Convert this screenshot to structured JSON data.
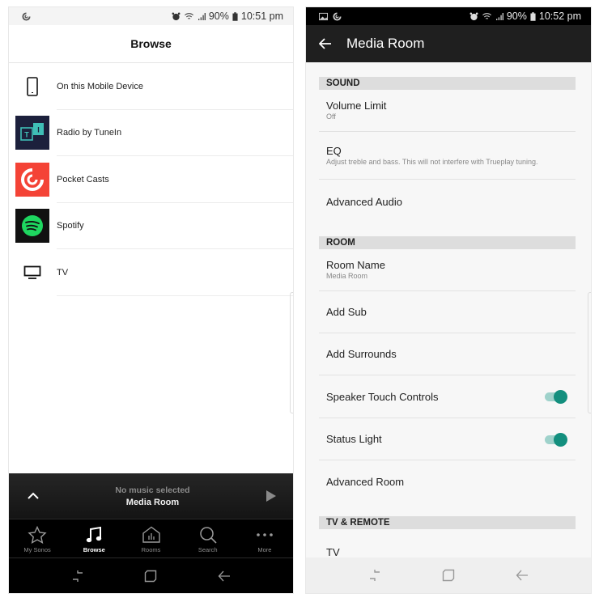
{
  "left_phone": {
    "status_bar": {
      "battery": "90%",
      "time": "10:51 pm"
    },
    "header": {
      "title": "Browse"
    },
    "sources": [
      {
        "label": "On this Mobile Device",
        "icon": "phone-icon"
      },
      {
        "label": "Radio by TuneIn",
        "icon": "tunein-logo-icon"
      },
      {
        "label": "Pocket Casts",
        "icon": "pocket-casts-logo-icon"
      },
      {
        "label": "Spotify",
        "icon": "spotify-logo-icon"
      },
      {
        "label": "TV",
        "icon": "tv-icon"
      }
    ],
    "mini_player": {
      "status": "No music selected",
      "room": "Media Room"
    },
    "tabs": [
      {
        "label": "My Sonos",
        "icon": "star-icon",
        "active": false
      },
      {
        "label": "Browse",
        "icon": "music-note-icon",
        "active": true
      },
      {
        "label": "Rooms",
        "icon": "rooms-icon",
        "active": false
      },
      {
        "label": "Search",
        "icon": "search-icon",
        "active": false
      },
      {
        "label": "More",
        "icon": "more-dots-icon",
        "active": false
      }
    ]
  },
  "right_phone": {
    "status_bar": {
      "battery": "90%",
      "time": "10:52 pm"
    },
    "app_bar": {
      "title": "Media Room"
    },
    "sections": [
      {
        "header": "SOUND",
        "rows": [
          {
            "title": "Volume Limit",
            "subtitle": "Off"
          },
          {
            "title": "EQ",
            "subtitle": "Adjust treble and bass. This will not interfere with Trueplay tuning."
          },
          {
            "title": "Advanced Audio"
          }
        ]
      },
      {
        "header": "ROOM",
        "rows": [
          {
            "title": "Room Name",
            "subtitle": "Media Room"
          },
          {
            "title": "Add Sub"
          },
          {
            "title": "Add Surrounds"
          },
          {
            "title": "Speaker Touch Controls",
            "toggle": true
          },
          {
            "title": "Status Light",
            "toggle": true
          },
          {
            "title": "Advanced Room"
          }
        ]
      },
      {
        "header": "TV & REMOTE",
        "rows": [
          {
            "title": "TV"
          }
        ]
      }
    ]
  },
  "colors": {
    "toggle_on": "#138f7e",
    "tunein_bg": "#1c203c",
    "tunein_accent": "#3fbfb7",
    "pocket_casts": "#f44336",
    "spotify_green": "#1ed760"
  }
}
